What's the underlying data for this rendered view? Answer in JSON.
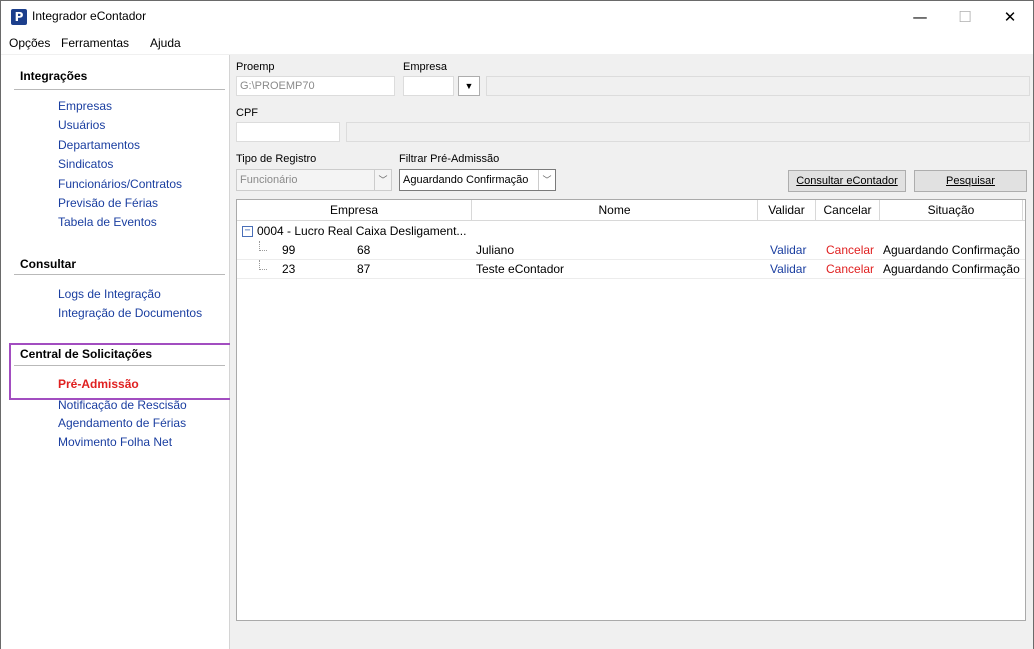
{
  "window": {
    "title": "Integrador eContador",
    "icon_label": "P",
    "controls": {
      "minimize": "—",
      "maximize": "☐",
      "close": "✕"
    }
  },
  "menu": [
    "Opções",
    "Ferramentas",
    "Ajuda"
  ],
  "nav": {
    "sections": [
      {
        "title": "Integrações",
        "items": [
          "Empresas",
          "Usuários",
          "Departamentos",
          "Sindicatos",
          "Funcionários/Contratos",
          "Previsão de Férias",
          "Tabela de Eventos"
        ]
      },
      {
        "title": "Consultar",
        "items": [
          "Logs de Integração",
          "Integração de Documentos"
        ]
      },
      {
        "title": "Central de Solicitações",
        "items": [
          "Pré-Admissão",
          "Notificação de Rescisão",
          "Agendamento de Férias",
          "Movimento Folha Net"
        ]
      }
    ],
    "active_item": "Pré-Admissão"
  },
  "form": {
    "proemp_label": "Proemp",
    "proemp_value": "G:\\PROEMP70",
    "empresa_label": "Empresa",
    "empresa_value": "",
    "empresa_name": "",
    "cpf_label": "CPF",
    "cpf_value": "",
    "cpf_name": "",
    "tipo_label": "Tipo de Registro",
    "tipo_value": "Funcionário",
    "filtro_label": "Filtrar Pré-Admissão",
    "filtro_value": "Aguardando Confirmação",
    "consultar_button": "Consultar eContador",
    "pesquisar_button": "Pesquisar"
  },
  "grid": {
    "columns": [
      "Empresa",
      "Nome",
      "Validar",
      "Cancelar",
      "Situação"
    ],
    "group": {
      "toggle": "−",
      "label": "0004 - Lucro Real Caixa Desligament..."
    },
    "rows": [
      {
        "c1": "99",
        "c2": "68",
        "nome": "Juliano",
        "validar": "Validar",
        "cancelar": "Cancelar",
        "situacao": "Aguardando Confirmação"
      },
      {
        "c1": "23",
        "c2": "87",
        "nome": "Teste eContador",
        "validar": "Validar",
        "cancelar": "Cancelar",
        "situacao": "Aguardando Confirmação"
      }
    ]
  },
  "colors": {
    "link": "#1a3ea0",
    "active": "#e02020",
    "highlight": "#a24dc0"
  },
  "icons": [
    "app-logo-icon",
    "minimize-icon",
    "maximize-icon",
    "close-icon",
    "chevron-down-icon",
    "collapse-icon"
  ]
}
